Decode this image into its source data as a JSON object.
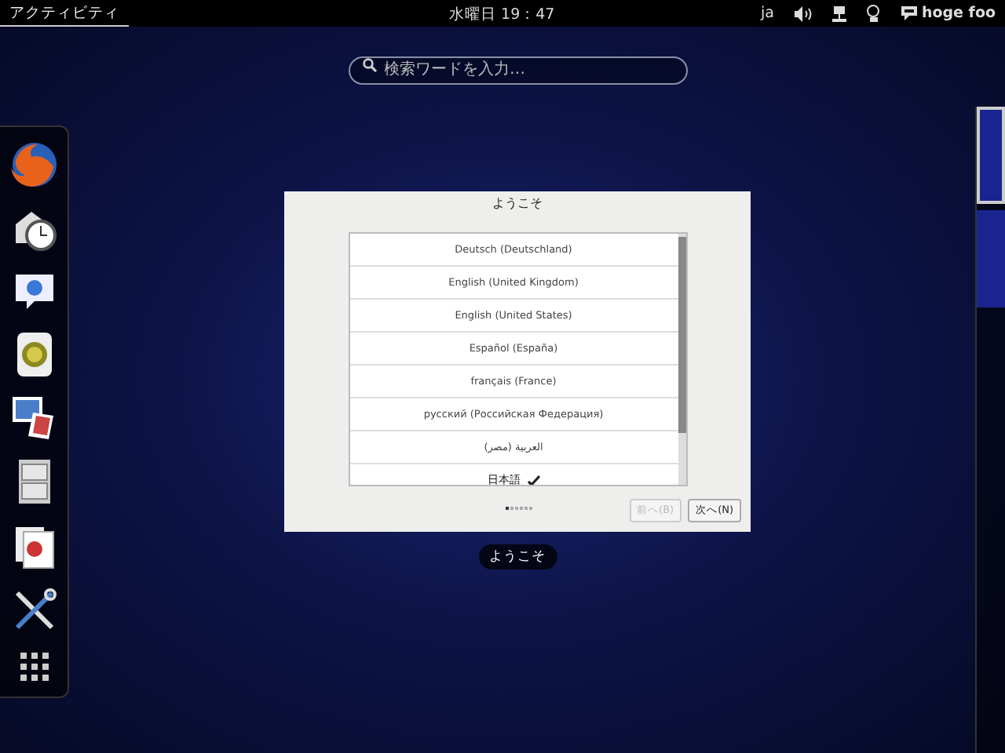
{
  "top_bar": {
    "activities": {
      "label": "アクティビティ",
      "selected": true
    },
    "clock": "水曜日 19：47",
    "input_method": "ja",
    "user_name": "hoge foo"
  },
  "search": {
    "placeholder": "検索ワードを入力…"
  },
  "dash": {
    "items": [
      {
        "kind": "browser"
      },
      {
        "kind": "clock"
      },
      {
        "kind": "chat"
      },
      {
        "kind": "media"
      },
      {
        "kind": "photos"
      },
      {
        "kind": "files"
      },
      {
        "kind": "documents"
      },
      {
        "kind": "tools"
      },
      {
        "kind": "apps"
      }
    ]
  },
  "dialog": {
    "title": "ようこそ",
    "languages": [
      {
        "label": "Deutsch (Deutschland)",
        "selected": false
      },
      {
        "label": "English (United Kingdom)",
        "selected": false
      },
      {
        "label": "English (United States)",
        "selected": false
      },
      {
        "label": "Español (España)",
        "selected": false
      },
      {
        "label": "français (France)",
        "selected": false
      },
      {
        "label": "русский (Российская Федерация)",
        "selected": false
      },
      {
        "label": "العربية (مصر)",
        "selected": false
      },
      {
        "label": "日本語",
        "selected": true
      }
    ],
    "pages": [
      {
        "selected": true
      },
      {
        "selected": false
      },
      {
        "selected": false
      },
      {
        "selected": false
      },
      {
        "selected": false
      },
      {
        "selected": false
      }
    ],
    "buttons": [
      {
        "label": "前へ(B)",
        "disabled": true
      },
      {
        "label": "次へ(N)",
        "disabled": false
      }
    ]
  },
  "window_caption": "ようこそ",
  "workspaces": [
    {
      "selected": true
    },
    {
      "selected": false
    }
  ]
}
